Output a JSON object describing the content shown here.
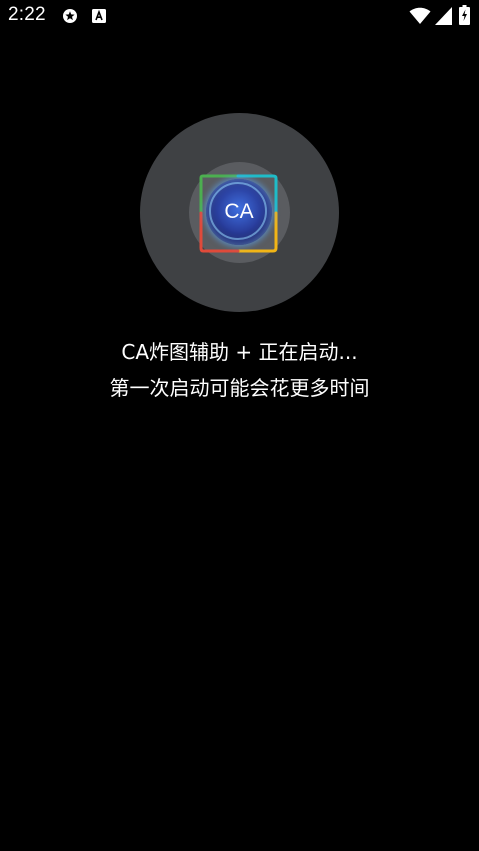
{
  "status_bar": {
    "time": "2:22",
    "icons": [
      "settings-gear-icon",
      "text-a-icon",
      "wifi-icon",
      "signal-icon",
      "battery-charging-icon"
    ]
  },
  "splash": {
    "logo_text": "CA",
    "title": "CA炸图辅助 + 正在启动...",
    "subtitle": "第一次启动可能会花更多时间"
  },
  "colors": {
    "background": "#000000",
    "circle": "#3f4144",
    "inner_ring": "#5a5c60",
    "frame_teal": "#1fbcc8",
    "frame_green": "#4caf50",
    "frame_red": "#e04a3a",
    "frame_yellow": "#f2b516",
    "text": "#ffffff"
  }
}
